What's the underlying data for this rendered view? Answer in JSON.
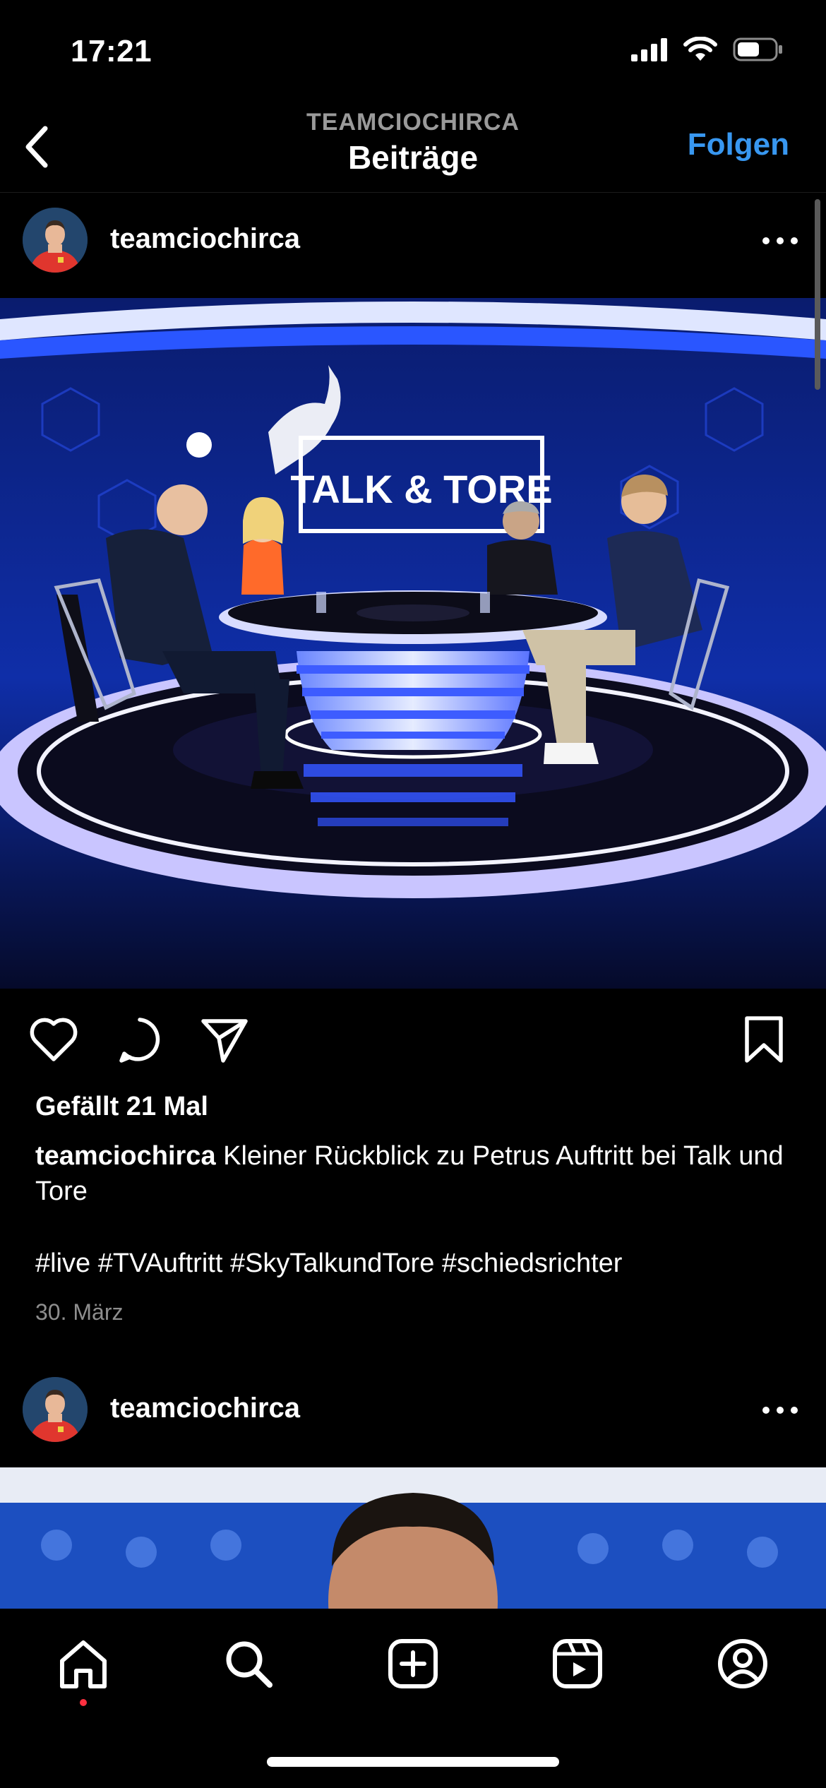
{
  "status_bar": {
    "time": "17:21"
  },
  "header": {
    "subtitle": "TEAMCIOCHIRCA",
    "title": "Beiträge",
    "follow_label": "Folgen"
  },
  "posts": [
    {
      "username": "teamciochirca",
      "image_text": "TALK & TORE",
      "likes": "Gefällt 21 Mal",
      "caption_user": "teamciochirca",
      "caption_text": "Kleiner Rückblick zu Petrus Auftritt bei Talk und Tore",
      "hashtags": "#live #TVAuftritt #SkyTalkundTore #schiedsrichter",
      "date": "30. März"
    },
    {
      "username": "teamciochirca"
    }
  ],
  "icons": {
    "back": "chevron-left-icon",
    "more": "more-dots-icon",
    "like": "heart-icon",
    "comment": "comment-icon",
    "share": "send-icon",
    "save": "bookmark-icon",
    "tabs": [
      "home-icon",
      "search-icon",
      "add-post-icon",
      "reels-icon",
      "profile-icon"
    ]
  },
  "colors": {
    "accent": "#3897f0",
    "notification": "#ff3040",
    "background": "#000000"
  }
}
